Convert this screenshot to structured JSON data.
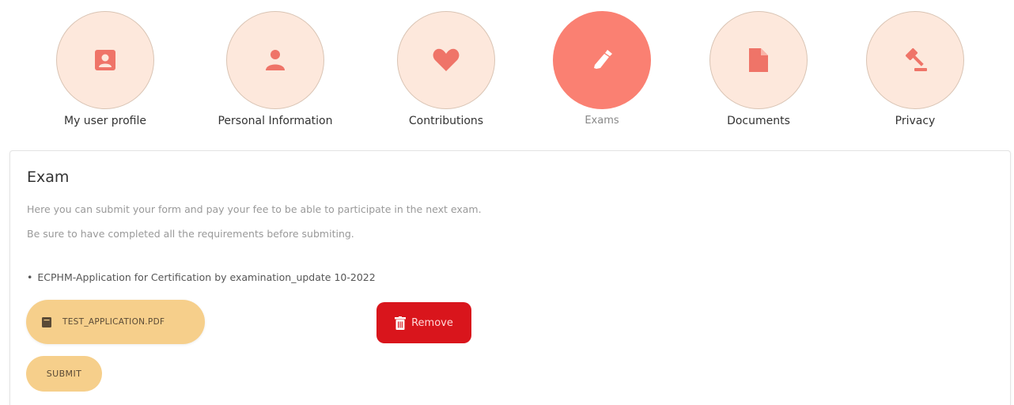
{
  "nav": {
    "items": [
      {
        "label": "My user profile",
        "icon": "profile-card-icon",
        "active": false
      },
      {
        "label": "Personal Information",
        "icon": "user-icon",
        "active": false
      },
      {
        "label": "Contributions",
        "icon": "heart-icon",
        "active": false
      },
      {
        "label": "Exams",
        "icon": "pen-icon",
        "active": true
      },
      {
        "label": "Documents",
        "icon": "document-icon",
        "active": false
      },
      {
        "label": "Privacy",
        "icon": "gavel-icon",
        "active": false
      }
    ]
  },
  "colors": {
    "circle_bg": "#fde8dc",
    "circle_active_bg": "#fa8072",
    "icon_color": "#ef7468",
    "button_bg": "#f6cf8b",
    "remove_bg": "#d9151c"
  },
  "exam": {
    "title": "Exam",
    "description": "Here you can submit your form and pay your fee to be able to participate in the next exam. Be sure to have completed all the requirements before submiting.",
    "requirements": [
      "ECPHM-Application for Certification by examination_update 10-2022"
    ],
    "file": {
      "name": "TEST_APPLICATION.PDF",
      "icon": "file-icon"
    },
    "remove_label": "Remove",
    "remove_icon": "trash-icon",
    "submit_label": "SUBMIT"
  }
}
